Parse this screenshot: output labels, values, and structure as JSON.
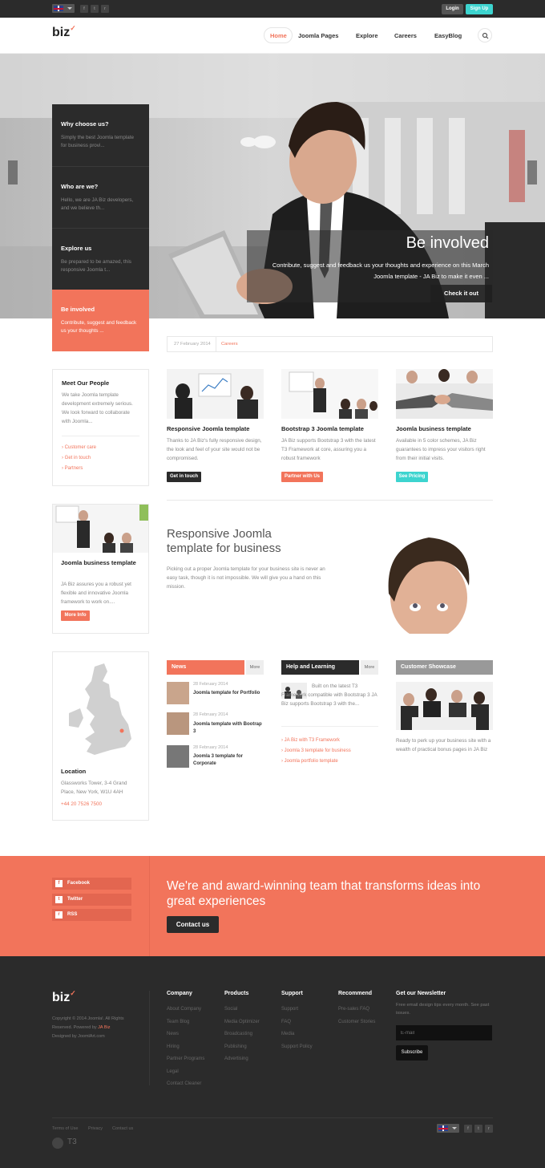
{
  "topbar": {
    "login": "Login",
    "signup": "Sign Up"
  },
  "header": {
    "logo": "biz",
    "nav": [
      "Home",
      "Joomla Pages",
      "Explore",
      "Careers",
      "EasyBlog"
    ]
  },
  "hero": {
    "side_items": [
      {
        "title": "Why choose us?",
        "text": "Simply the best Joomla template for business provi..."
      },
      {
        "title": "Who are we?",
        "text": "Hello, we are JA Biz developers, and we believe th..."
      },
      {
        "title": "Explore us",
        "text": "Be prepared to be amazed, this responsive Joomla t..."
      },
      {
        "title": "Be involved",
        "text": "Contribute, suggest and feedback us your thoughts ..."
      }
    ],
    "caption_title": "Be involved",
    "caption_text": "Contribute, suggest and feedback us your thoughts and experience on this March Joomla template - JA Biz to make it even ...",
    "caption_button": "Check it out"
  },
  "meta": {
    "date": "27 February 2014",
    "category": "Careers"
  },
  "people": {
    "title": "Meet Our People",
    "text": "We take Joomla template development extremely serious. We look forward to collaborate with Joomla...",
    "links": [
      "Customer care",
      "Get in touch",
      "Partners"
    ]
  },
  "cards": [
    {
      "title": "Responsive Joomla template",
      "text": "Thanks to JA Biz's fully responsive design, the look and feel of your site would not be compromised.",
      "button": "Get in touch"
    },
    {
      "title": "Bootstrap 3 Joomla template",
      "text": "JA Biz supports Bootstrap 3 with the latest T3 Framework at core, assuring you a robust framework",
      "button": "Partner with Us"
    },
    {
      "title": "Joomla business template",
      "text": "Available in 5 color schemes, JA Biz guarantees to impress your visitors right from their initial visits.",
      "button": "See Pricing"
    }
  ],
  "business_box": {
    "title": "Joomla business template",
    "text": "JA Biz assures you a robust yet flexible and innovative Joomla framework to work on....",
    "button": "More Info"
  },
  "feature": {
    "title": "Responsive Joomla template for business",
    "text": "Picking out a proper Joomla template for your business site is never an easy task, though it is not impossible. We will give you a hand on this mission."
  },
  "location": {
    "title": "Location",
    "address": "Glassworks Tower, 3-4 Grand Place, New York, W1U 4AH",
    "phone": "+44 20 7526 7500"
  },
  "news": {
    "tab": "News",
    "more": "More",
    "items": [
      {
        "date": "28 February 2014",
        "title": "Joomla template for Portfolio"
      },
      {
        "date": "28 February 2014",
        "title": "Joomla template with Bootrap 3"
      },
      {
        "date": "28 February 2014",
        "title": "Joomla 3 template for Corporate"
      }
    ]
  },
  "help": {
    "tab": "Help and Learning",
    "more": "More",
    "text": "Built on the latest T3 Framework compatible with Bootstrap 3 JA Biz supports Bootstrap 3 with the...",
    "links": [
      "JA Biz with T3 Framework",
      "Joomla 3 template for business",
      "Joomla portfolio template"
    ]
  },
  "showcase": {
    "tab": "Customer Showcase",
    "text": "Ready to perk up your business site with a wealth of practical bonus pages in JA Biz"
  },
  "cta": {
    "social": [
      "Facebook",
      "Twitter",
      "RSS"
    ],
    "headline": "We're and award-winning team that transforms ideas into great experiences",
    "button": "Contact us"
  },
  "footer": {
    "logo": "biz",
    "copyright_1": "Copyright © 2014 Joomla!. All Rights",
    "copyright_2": "Reserved. Powered by",
    "powered_by": "JA Biz",
    "copyright_3": "Designed by JoomlArt.com",
    "columns": [
      {
        "title": "Company",
        "links": [
          "About Company",
          "Team Blog",
          "News",
          "Hiring",
          "Partner Programs",
          "Legal",
          "Contact Cleaner"
        ]
      },
      {
        "title": "Products",
        "links": [
          "Social",
          "Media Optimizer",
          "Broadcasting",
          "Publishing",
          "Advertising"
        ]
      },
      {
        "title": "Support",
        "links": [
          "Support",
          "FAQ",
          "Media",
          "Support Policy"
        ]
      },
      {
        "title": "Recommend",
        "links": [
          "Pre-sales FAQ",
          "Customer Stories"
        ]
      }
    ],
    "newsletter_title": "Get our Newsletter",
    "newsletter_text": "Free email design tips every month. See past issues.",
    "email_placeholder": "E-mail",
    "subscribe": "Subscribe",
    "bottom_links": [
      "Terms of Use",
      "Privacy",
      "Contact us"
    ],
    "t3": "T3"
  }
}
